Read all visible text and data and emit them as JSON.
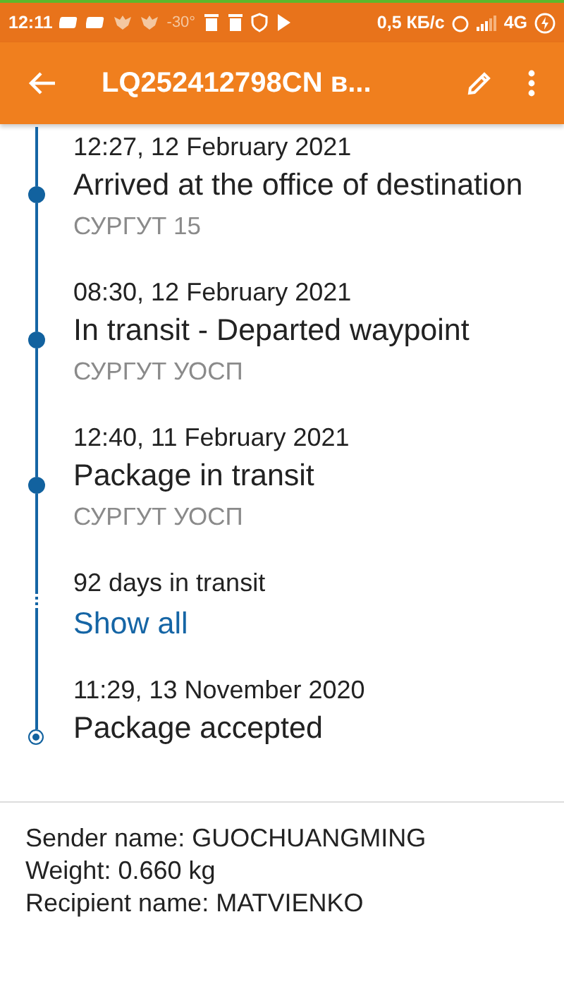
{
  "status_bar": {
    "time": "12:11",
    "temperature": "-30°",
    "speed": "0,5 КБ/с",
    "network": "4G"
  },
  "toolbar": {
    "title": "LQ252412798CN в..."
  },
  "timeline": [
    {
      "kind": "event",
      "date": "12:27, 12 February 2021",
      "title": "Arrived at the office of destination",
      "location": "СУРГУТ 15"
    },
    {
      "kind": "event",
      "date": "08:30, 12 February 2021",
      "title": "In transit - Departed waypoint",
      "location": "СУРГУТ УОСП"
    },
    {
      "kind": "event",
      "date": "12:40, 11 February 2021",
      "title": "Package in transit",
      "location": "СУРГУТ УОСП"
    },
    {
      "kind": "gap",
      "title": "92 days in transit",
      "link": "Show all"
    },
    {
      "kind": "origin",
      "date": "11:29, 13 November 2020",
      "title": "Package accepted"
    }
  ],
  "details": [
    "Sender name: GUOCHUANGMING",
    "Weight: 0.660 kg",
    "Recipient name: MATVIENKO"
  ]
}
